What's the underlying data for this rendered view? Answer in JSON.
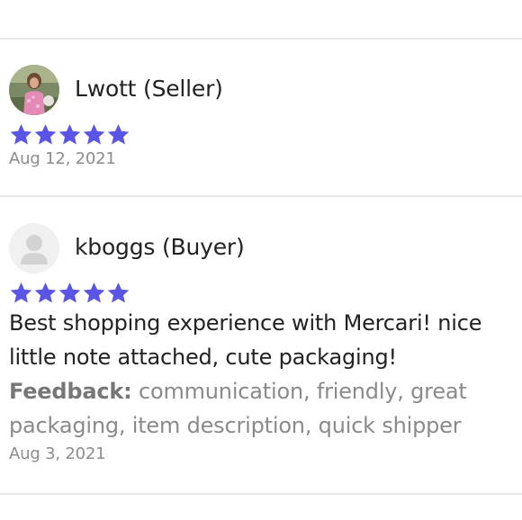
{
  "colors": {
    "star": "#5a55e6",
    "divider": "#e9e9e9",
    "name_text": "#222222",
    "date_text": "#8c8c8c",
    "feedback_text": "#8a8a8a"
  },
  "reviews": [
    {
      "reviewer": "Lwott (Seller)",
      "avatar_icon": "profile-photo",
      "rating": 5,
      "date": "Aug 12, 2021"
    },
    {
      "reviewer": "kboggs (Buyer)",
      "avatar_icon": "default-user-icon",
      "rating": 5,
      "comment_line1": "Best shopping experience with Mercari!  nice",
      "comment_line2": "little note attached, cute packaging!",
      "feedback_label": "Feedback:",
      "feedback_line1": " communication, friendly, great",
      "feedback_line2": "packaging, item description, quick shipper",
      "date": "Aug 3, 2021"
    }
  ]
}
